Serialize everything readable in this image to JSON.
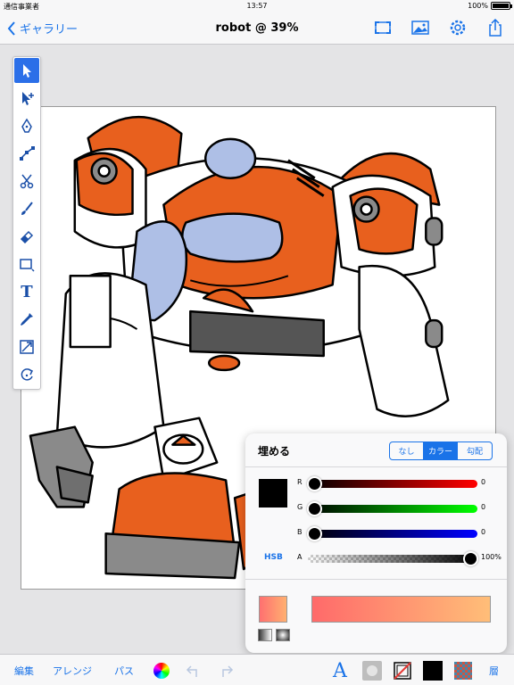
{
  "status_bar": {
    "carrier": "通信事業者",
    "time": "13:57",
    "battery": "100%"
  },
  "nav": {
    "back_label": "ギャラリー",
    "title": "robot @ 39%",
    "icons": [
      "fit-screen-icon",
      "image-icon",
      "gear-icon",
      "share-icon"
    ]
  },
  "tools": [
    "selection-arrow-icon",
    "direct-selection-icon",
    "pen-icon",
    "node-edit-icon",
    "scissors-icon",
    "brush-icon",
    "eraser-icon",
    "shape-rectangle-icon",
    "text-tool-icon",
    "eyedropper-icon",
    "transform-icon",
    "rotate-icon"
  ],
  "text_tool_glyph": "T",
  "fill_panel": {
    "title": "埋める",
    "segments": [
      "なし",
      "カラー",
      "勾配"
    ],
    "selected_segment": "カラー",
    "swatch_color": "#000000",
    "sliders": [
      {
        "label": "R",
        "value": "0"
      },
      {
        "label": "G",
        "value": "0"
      },
      {
        "label": "B",
        "value": "0"
      },
      {
        "label": "A",
        "value": "100%"
      }
    ],
    "hsb_label": "HSB"
  },
  "bottom_toolbar": {
    "edit_label": "編集",
    "arrange_label": "アレンジ",
    "path_label": "パス",
    "layers_label": "層",
    "text_glyph": "A"
  },
  "colors": {
    "accent": "#1a73e8",
    "robot_orange": "#e8601e",
    "robot_blue": "#aebfe6",
    "robot_gray": "#8a8a8a"
  }
}
